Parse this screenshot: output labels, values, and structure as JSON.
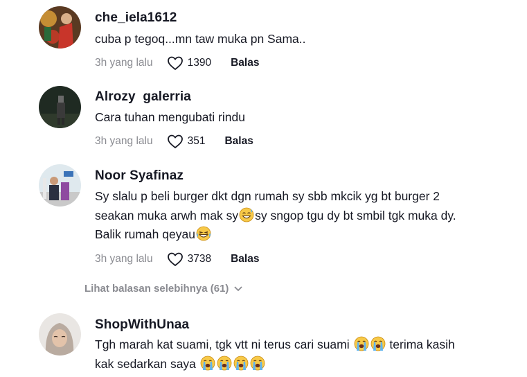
{
  "comments": [
    {
      "username": "che_iela1612",
      "text": "cuba p tegoq...mn taw muka pn Sama..",
      "time": "3h yang lalu",
      "likes": "1390",
      "reply": "Balas"
    },
    {
      "username": "Alrozy  galerria",
      "text": "Cara tuhan mengubati rindu",
      "time": "3h yang lalu",
      "likes": "351",
      "reply": "Balas"
    },
    {
      "username": "Noor Syafinaz",
      "text_line1": "Sy slalu p beli burger dkt dgn rumah sy sbb mkcik yg bt burger 2",
      "text_line2a": "seakan muka arwh mak sy",
      "text_line2b": "sy sngop tgu dy bt smbil tgk muka dy.",
      "text_line3": "Balik rumah qeyau",
      "time": "3h yang lalu",
      "likes": "3738",
      "reply": "Balas"
    },
    {
      "username": "ShopWithUnaa",
      "text_line1": "Tgh marah kat suami, tgk vtt ni terus cari suami",
      "text_line1b": "terima kasih",
      "text_line2": "kak sedarkan saya"
    }
  ],
  "more_replies": "Lihat balasan selebihnya (61)",
  "icons": {
    "like": "heart-outline-icon",
    "more": "chevron-down-icon",
    "emoji_sweat": "grinning-sweat-emoji",
    "emoji_laugh": "laughing-tears-emoji",
    "emoji_cry": "loudly-crying-emoji"
  },
  "colors": {
    "text": "#161823",
    "muted": "#8a8b91"
  }
}
